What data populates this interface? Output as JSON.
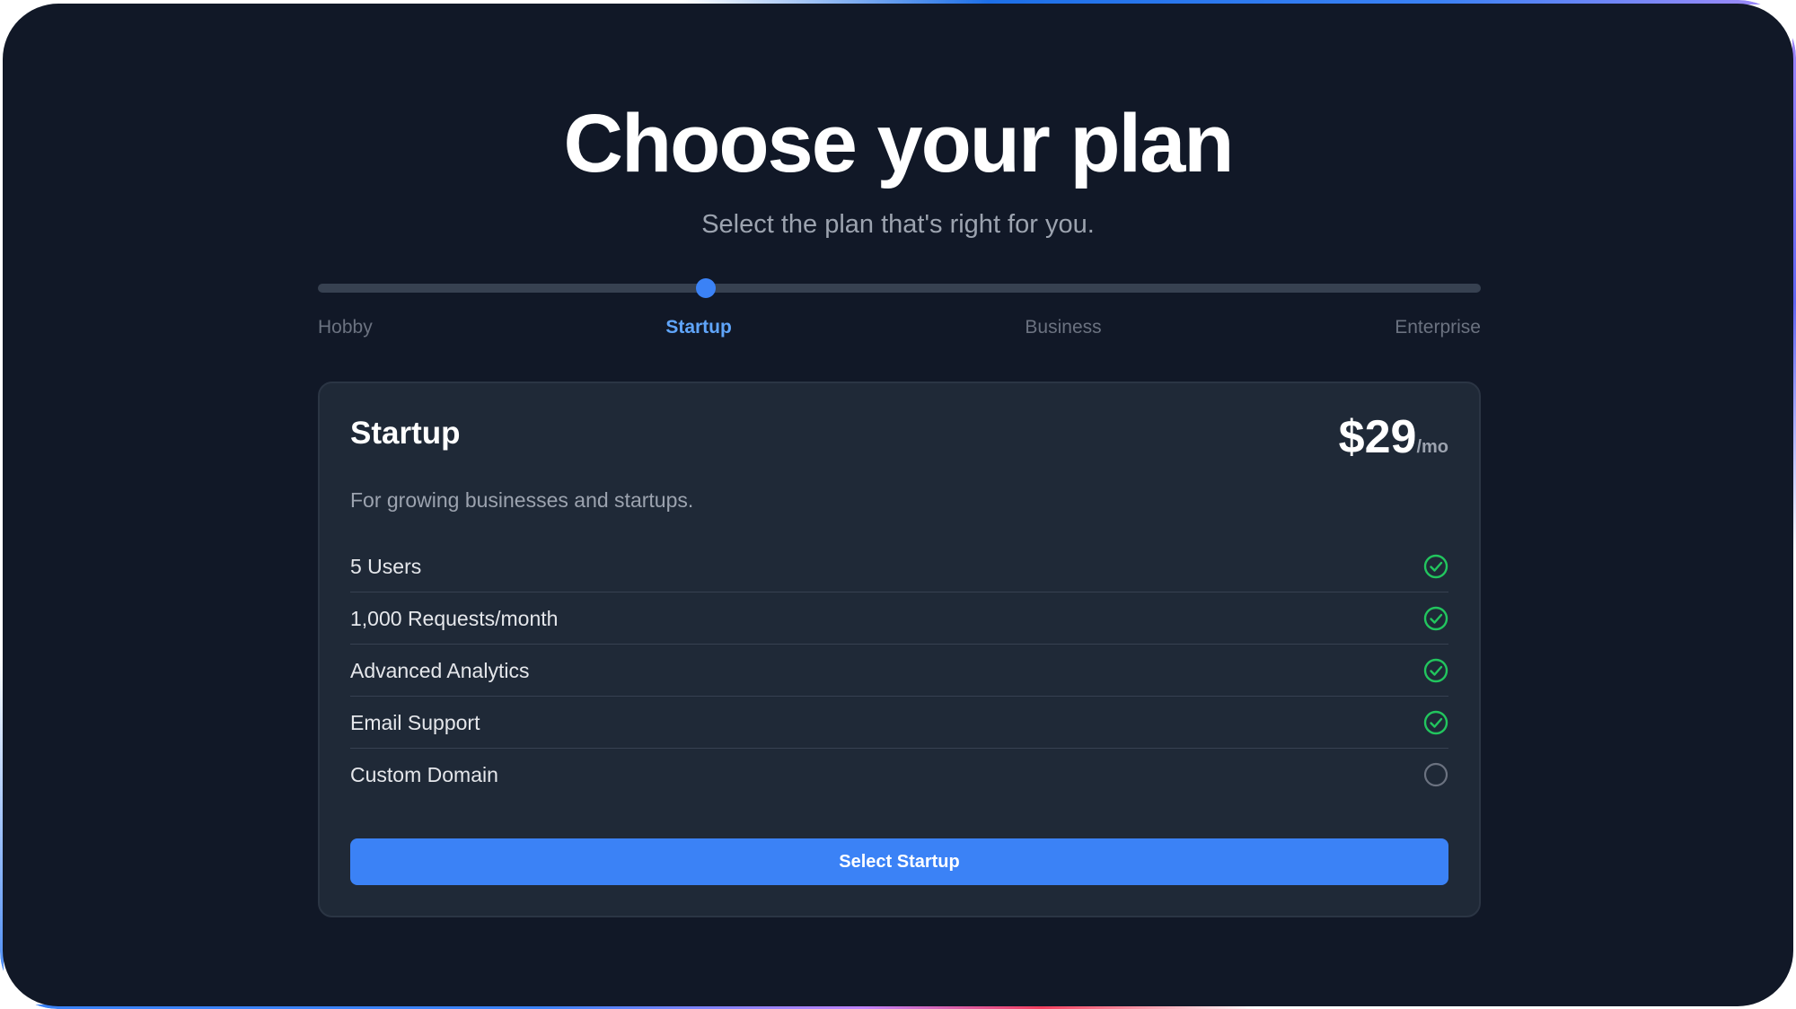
{
  "header": {
    "title": "Choose your plan",
    "subtitle": "Select the plan that's right for you."
  },
  "slider": {
    "selected_index": 1,
    "tiers": [
      {
        "label": "Hobby"
      },
      {
        "label": "Startup"
      },
      {
        "label": "Business"
      },
      {
        "label": "Enterprise"
      }
    ]
  },
  "plan": {
    "name": "Startup",
    "price": "$29",
    "period": "/mo",
    "description": "For growing businesses and startups.",
    "features": [
      {
        "label": "5 Users",
        "included": true,
        "icon": "check-circle-icon"
      },
      {
        "label": "1,000 Requests/month",
        "included": true,
        "icon": "check-circle-icon"
      },
      {
        "label": "Advanced Analytics",
        "included": true,
        "icon": "check-circle-icon"
      },
      {
        "label": "Email Support",
        "included": true,
        "icon": "check-circle-icon"
      },
      {
        "label": "Custom Domain",
        "included": false,
        "icon": "empty-circle-icon"
      }
    ],
    "cta_label": "Select Startup"
  },
  "colors": {
    "background": "#111827",
    "card": "#1f2937",
    "accent": "#3b82f6",
    "active_tier": "#60a5fa",
    "included": "#22c55e",
    "not_included": "#6b7280"
  }
}
